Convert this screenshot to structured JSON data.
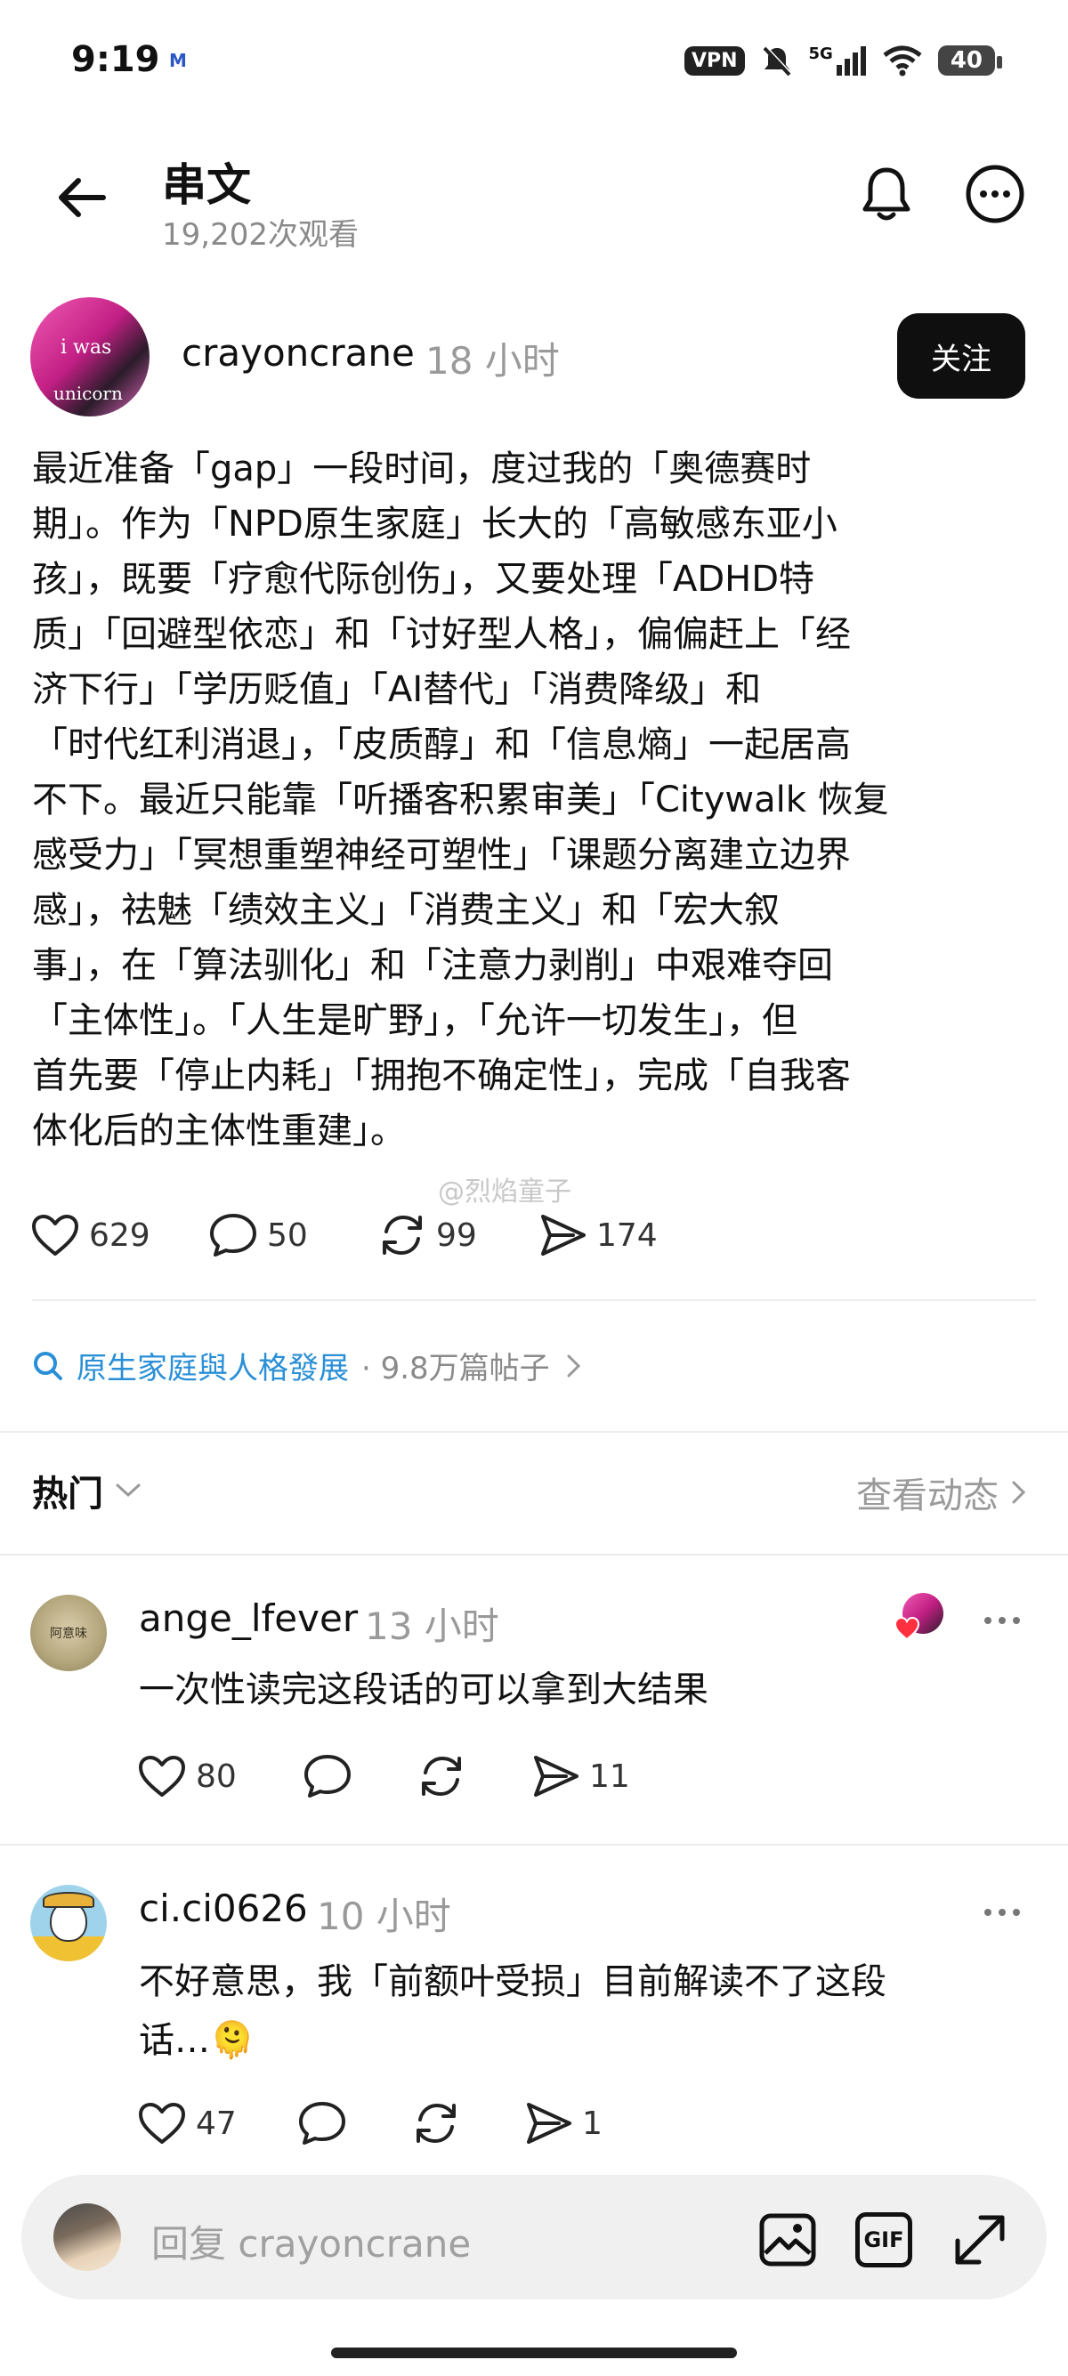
{
  "status_bar": {
    "time": "9:19",
    "mail_badge": "M",
    "vpn": "VPN",
    "network": "5G",
    "battery": "40"
  },
  "header": {
    "title": "串文",
    "views": "19,202次观看"
  },
  "post": {
    "username": "crayoncrane",
    "time": "18 小时",
    "follow_label": "关注",
    "avatar_text_1": "i was",
    "avatar_text_2": "unicorn",
    "body": "最近准备「gap」一段时间，度过我的「奥德赛时\n期」。作为「NPD原生家庭」长大的「高敏感东亚小\n孩」，既要「疗愈代际创伤」，又要处理「ADHD特\n质」「回避型依恋」和「讨好型人格」，偏偏赶上「经\n济下行」「学历贬值」「AI替代」「消费降级」和\n「时代红利消退」，「皮质醇」和「信息熵」一起居高\n不下。最近只能靠「听播客积累审美」「Citywalk 恢复\n感受力」「冥想重塑神经可塑性」「课题分离建立边界\n感」，祛魅「绩效主义」「消费主义」和「宏大叙\n事」，在「算法驯化」和「注意力剥削」中艰难夺回\n「主体性」。「人生是旷野」，「允许一切发生」，但\n首先要「停止内耗」「拥抱不确定性」，完成「自我客\n体化后的主体性重建」。",
    "watermark": "@烈焰童子",
    "likes": "629",
    "comments": "50",
    "reposts": "99",
    "shares": "174"
  },
  "topic": {
    "name": "原生家庭與人格發展",
    "count": "· 9.8万篇帖子"
  },
  "sort": {
    "label": "热门",
    "activity_link": "查看动态"
  },
  "comments": [
    {
      "username": "ange_lfever",
      "time": "13 小时",
      "text": "一次性读完这段话的可以拿到大结果",
      "avatar_text": "阿意味",
      "likes": "80",
      "shares": "11"
    },
    {
      "username": "ci.ci0626",
      "time": "10 小时",
      "text": "不好意思，我「前额叶受损」目前解读不了这段\n话…🫠",
      "likes": "47",
      "shares": "1"
    }
  ],
  "reply_bar": {
    "placeholder": "回复 crayoncrane",
    "gif_label": "GIF"
  },
  "colors": {
    "accent_link": "#2a8fd6",
    "follow_bg": "#0f0f0f",
    "muted_text": "#9a9a9a"
  }
}
